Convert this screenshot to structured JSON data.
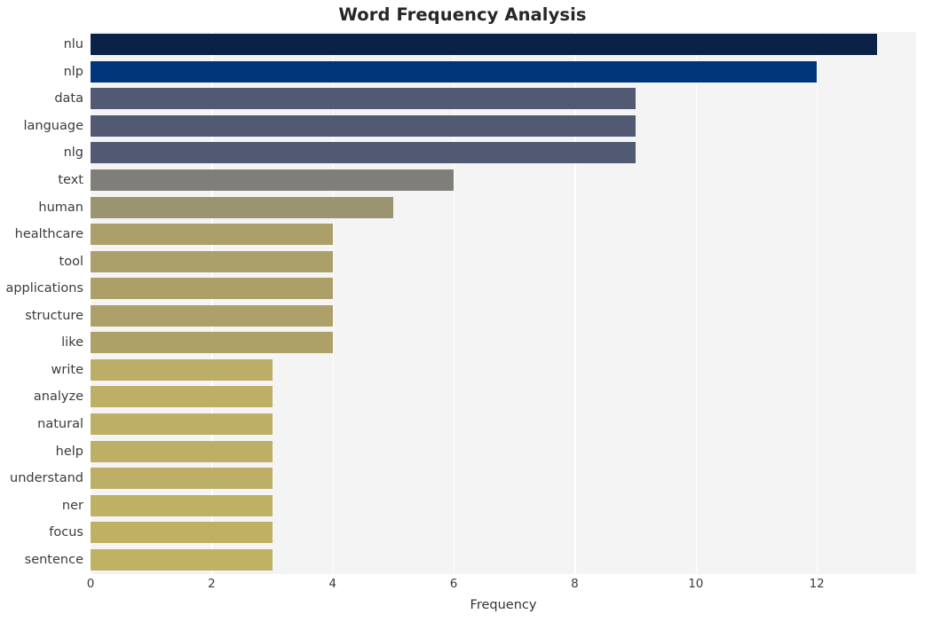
{
  "chart_data": {
    "type": "bar",
    "orientation": "horizontal",
    "title": "Word Frequency Analysis",
    "xlabel": "Frequency",
    "ylabel": "",
    "categories": [
      "nlu",
      "nlp",
      "data",
      "language",
      "nlg",
      "text",
      "human",
      "healthcare",
      "tool",
      "applications",
      "structure",
      "like",
      "write",
      "analyze",
      "natural",
      "help",
      "understand",
      "ner",
      "focus",
      "sentence"
    ],
    "values": [
      13,
      12,
      9,
      9,
      9,
      6,
      5,
      4,
      4,
      4,
      4,
      4,
      3,
      3,
      3,
      3,
      3,
      3,
      3,
      3
    ],
    "bar_colors": [
      "#0a2247",
      "#00377a",
      "#525a73",
      "#525a73",
      "#525a73",
      "#807e78",
      "#9b9470",
      "#ab9f6a",
      "#ab9f6a",
      "#ac9f68",
      "#ada068",
      "#aea167",
      "#bcae66",
      "#bdaf66",
      "#bdaf65",
      "#bdaf65",
      "#bdaf65",
      "#bfb164",
      "#bfb164",
      "#c0b264"
    ],
    "xticks": [
      0,
      2,
      4,
      6,
      8,
      10,
      12
    ],
    "xlim": [
      0,
      13.64
    ],
    "ylim_count": 20,
    "grid": true,
    "grid_color": "#ffffff",
    "plot_background": "#f4f4f5",
    "figure_background": "#ffffff",
    "legend": null,
    "style": "seaborn-darkgrid"
  }
}
